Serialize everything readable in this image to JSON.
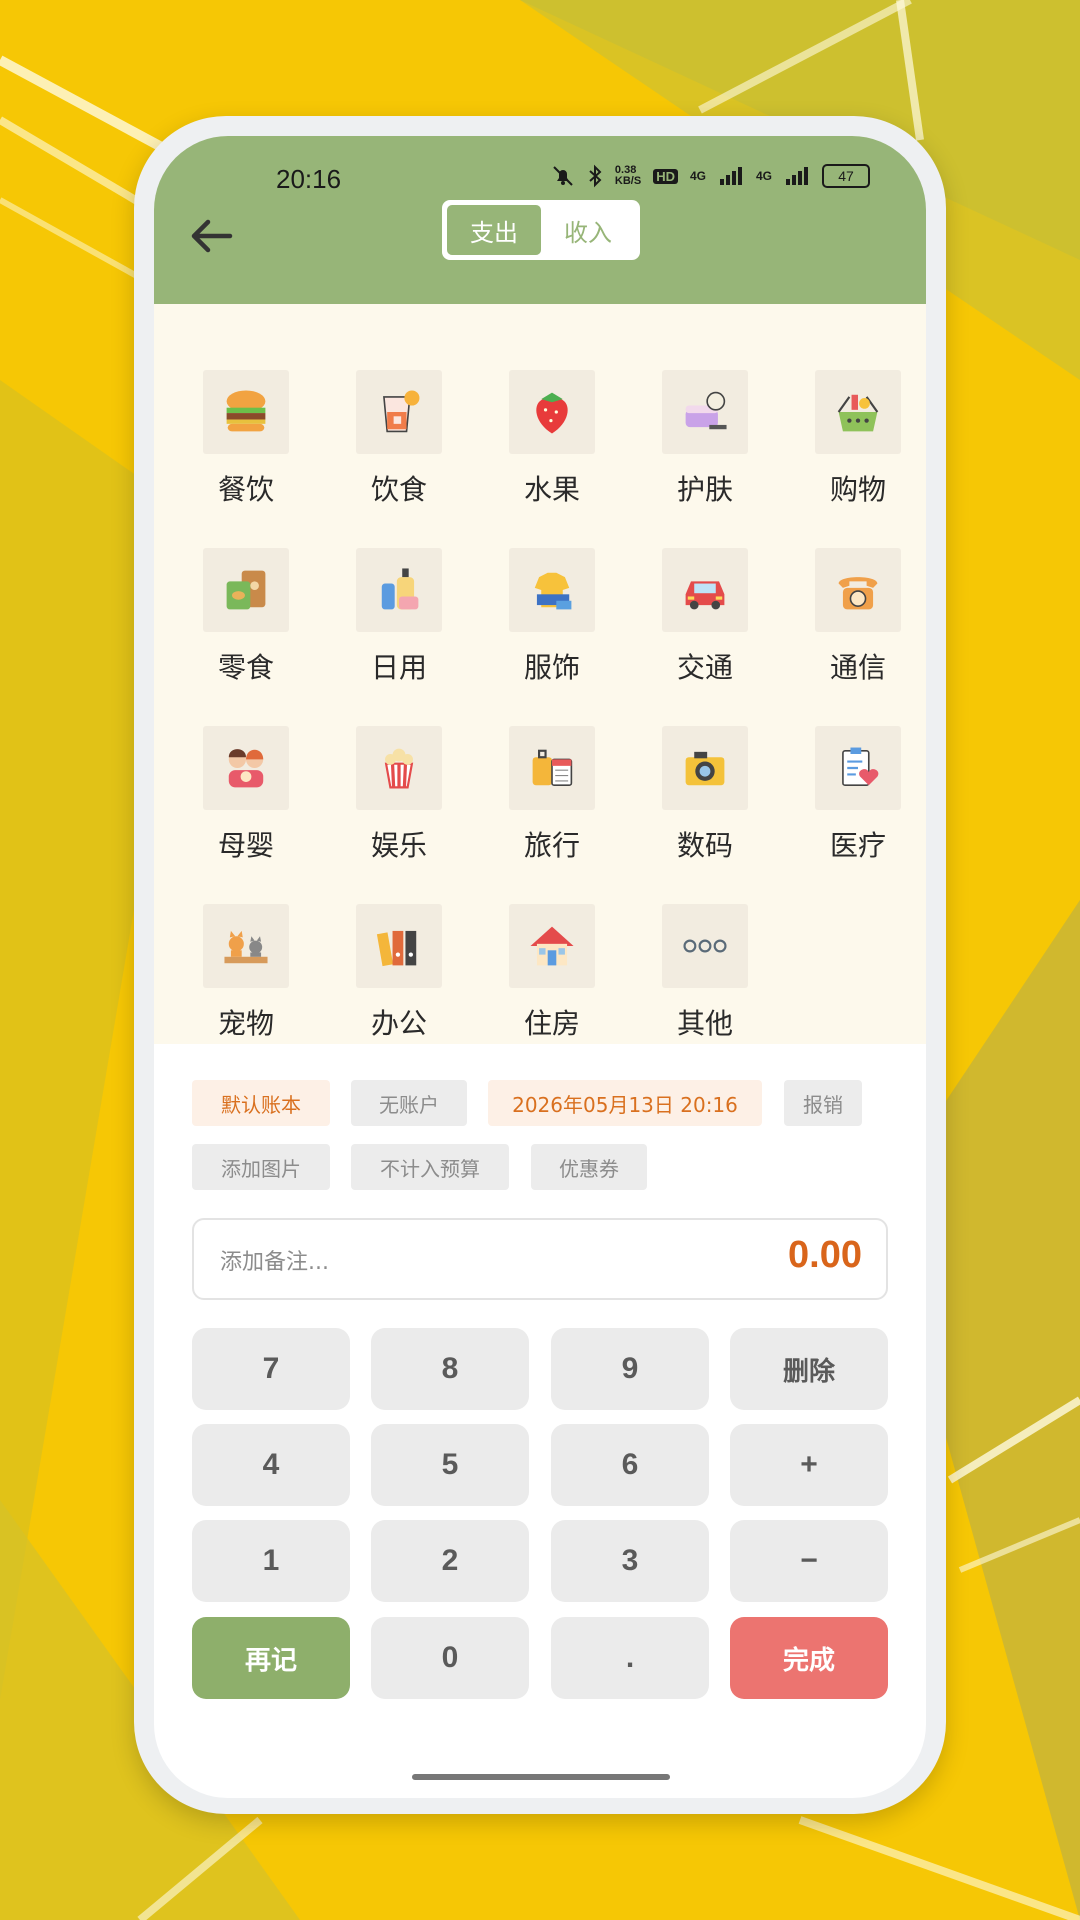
{
  "status_bar": {
    "time": "20:16",
    "battery": "47",
    "speed": "0.38\nKB/S",
    "hd": "HD",
    "net1": "4G",
    "net2": "4G"
  },
  "header": {
    "tabs": [
      {
        "label": "支出",
        "active": true
      },
      {
        "label": "收入",
        "active": false
      }
    ]
  },
  "categories": [
    {
      "label": "餐饮",
      "icon": "burger-icon"
    },
    {
      "label": "饮食",
      "icon": "drink-icon"
    },
    {
      "label": "水果",
      "icon": "strawberry-icon"
    },
    {
      "label": "护肤",
      "icon": "skincare-icon"
    },
    {
      "label": "购物",
      "icon": "shopping-basket-icon"
    },
    {
      "label": "零食",
      "icon": "snack-icon"
    },
    {
      "label": "日用",
      "icon": "daily-bottles-icon"
    },
    {
      "label": "服饰",
      "icon": "clothes-icon"
    },
    {
      "label": "交通",
      "icon": "car-icon"
    },
    {
      "label": "通信",
      "icon": "telephone-icon"
    },
    {
      "label": "母婴",
      "icon": "mother-baby-icon"
    },
    {
      "label": "娱乐",
      "icon": "popcorn-icon"
    },
    {
      "label": "旅行",
      "icon": "luggage-icon"
    },
    {
      "label": "数码",
      "icon": "camera-icon"
    },
    {
      "label": "医疗",
      "icon": "medical-icon"
    },
    {
      "label": "宠物",
      "icon": "pets-icon"
    },
    {
      "label": "办公",
      "icon": "binders-icon"
    },
    {
      "label": "住房",
      "icon": "house-icon"
    },
    {
      "label": "其他",
      "icon": "more-dots-icon"
    }
  ],
  "tags": {
    "account_book": "默认账本",
    "account": "无账户",
    "datetime": "2026年05月13日 20:16",
    "reimburse": "报销",
    "add_image": "添加图片",
    "exclude_budget": "不计入预算",
    "coupon": "优惠券"
  },
  "note": {
    "placeholder": "添加备注...",
    "amount": "0.00"
  },
  "keypad": {
    "k7": "7",
    "k8": "8",
    "k9": "9",
    "delete": "删除",
    "k4": "4",
    "k5": "5",
    "k6": "6",
    "plus": "+",
    "k1": "1",
    "k2": "2",
    "k3": "3",
    "minus": "−",
    "again": "再记",
    "k0": "0",
    "dot": ".",
    "done": "完成"
  },
  "colors": {
    "header_green": "#97b578",
    "accent_orange": "#d9651b",
    "done_red": "#ec7470",
    "again_green": "#8eaf6b",
    "background_yellow": "#f6c705"
  }
}
